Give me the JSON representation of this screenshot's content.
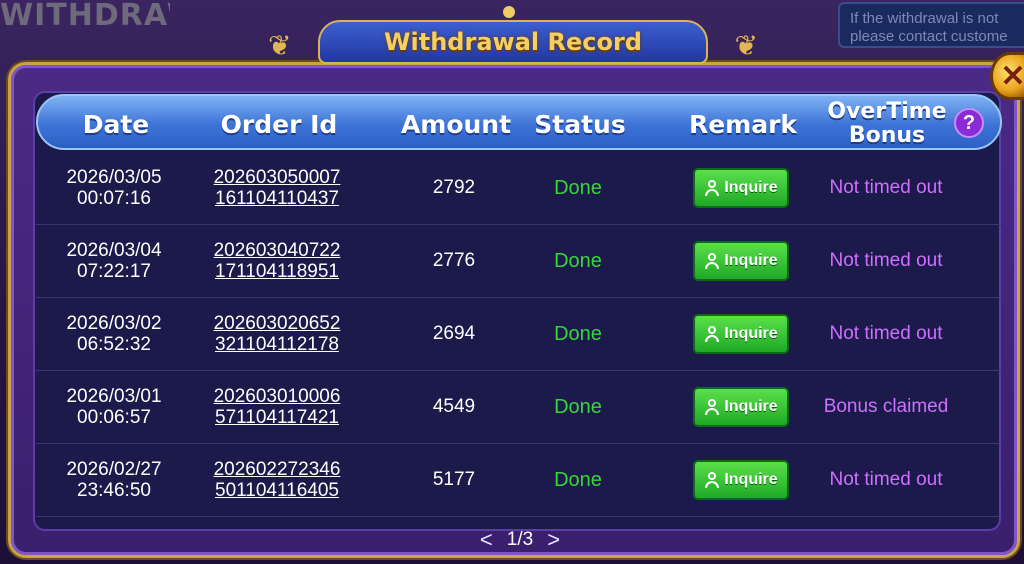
{
  "background": {
    "title": "WITHDRAW",
    "notice_line1": "If the withdrawal is not",
    "notice_line2": "please contact custome"
  },
  "dialog": {
    "title": "Withdrawal Record",
    "close_icon": "close-x-icon"
  },
  "columns": {
    "date": "Date",
    "order_id": "Order Id",
    "amount": "Amount",
    "status": "Status",
    "remark": "Remark",
    "bonus_line1": "OverTime",
    "bonus_line2": "Bonus",
    "help_icon": "?"
  },
  "rows": [
    {
      "date": "2026/03/05",
      "time": "00:07:16",
      "order_1": "202603050007",
      "order_2": "161104110437",
      "amount": "2792",
      "status": "Done",
      "remark": "Inquire",
      "bonus": "Not timed out"
    },
    {
      "date": "2026/03/04",
      "time": "07:22:17",
      "order_1": "202603040722",
      "order_2": "171104118951",
      "amount": "2776",
      "status": "Done",
      "remark": "Inquire",
      "bonus": "Not timed out"
    },
    {
      "date": "2026/03/02",
      "time": "06:52:32",
      "order_1": "202603020652",
      "order_2": "321104112178",
      "amount": "2694",
      "status": "Done",
      "remark": "Inquire",
      "bonus": "Not timed out"
    },
    {
      "date": "2026/03/01",
      "time": "00:06:57",
      "order_1": "202603010006",
      "order_2": "571104117421",
      "amount": "4549",
      "status": "Done",
      "remark": "Inquire",
      "bonus": "Bonus claimed"
    },
    {
      "date": "2026/02/27",
      "time": "23:46:50",
      "order_1": "202602272346",
      "order_2": "501104116405",
      "amount": "5177",
      "status": "Done",
      "remark": "Inquire",
      "bonus": "Not timed out"
    }
  ],
  "pagination": {
    "prev": "<",
    "page": "1/3",
    "next": ">"
  },
  "colors": {
    "status_done": "#36d63a",
    "bonus_text": "#cf6fff",
    "title_gold": "#f6cf63",
    "header_blue": "#3d74d7",
    "inquire_green": "#1fa827"
  }
}
